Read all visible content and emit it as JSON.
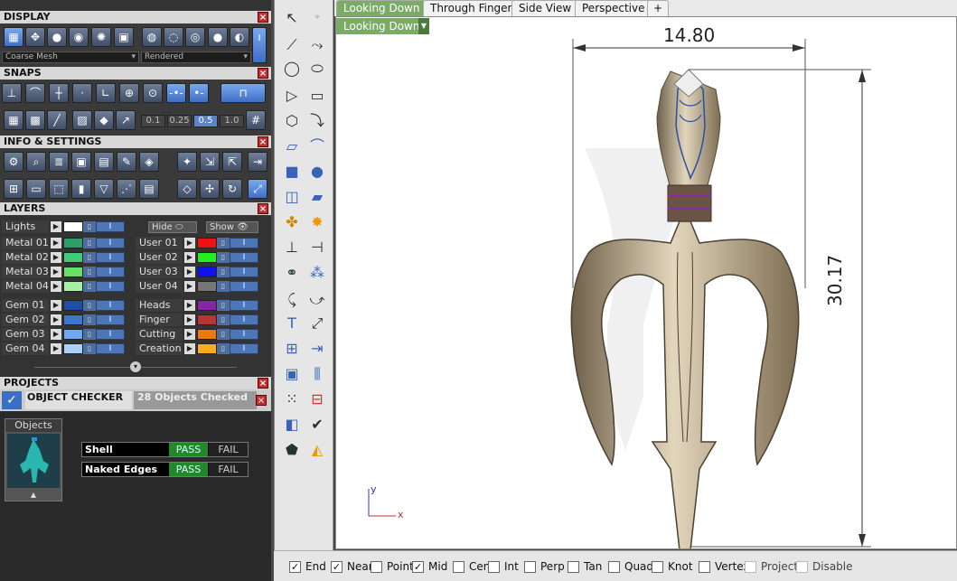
{
  "display": {
    "title": "DISPLAY",
    "mesh_select": "Coarse Mesh",
    "render_select": "Rendered"
  },
  "snaps": {
    "title": "SNAPS",
    "steps": [
      "0.1",
      "0.25",
      "0.5",
      "1.0"
    ],
    "active_step": "0.5"
  },
  "info": {
    "title": "INFO & SETTINGS"
  },
  "layers": {
    "title": "LAYERS",
    "lights_label": "Lights",
    "hide_label": "Hide",
    "show_label": "Show",
    "left": [
      {
        "name": "Metal 01",
        "color": "#2e9e6a"
      },
      {
        "name": "Metal 02",
        "color": "#3fcc7a"
      },
      {
        "name": "Metal 03",
        "color": "#66e066"
      },
      {
        "name": "Metal 04",
        "color": "#a8f0a8"
      },
      {
        "name": "Gem 01",
        "color": "#1f4da8"
      },
      {
        "name": "Gem 02",
        "color": "#3d78cc"
      },
      {
        "name": "Gem 03",
        "color": "#6fa8ee"
      },
      {
        "name": "Gem 04",
        "color": "#a8d0f8"
      }
    ],
    "right": [
      {
        "name": "User 01",
        "color": "#ee1111"
      },
      {
        "name": "User 02",
        "color": "#22ee22"
      },
      {
        "name": "User 03",
        "color": "#1111ee"
      },
      {
        "name": "User 04",
        "color": "#777777"
      },
      {
        "name": "Heads",
        "color": "#8a22aa"
      },
      {
        "name": "Finger",
        "color": "#bb3333"
      },
      {
        "name": "Cutting",
        "color": "#ee7711"
      },
      {
        "name": "Creation",
        "color": "#ffaa22"
      }
    ]
  },
  "projects": {
    "title": "PROJECTS"
  },
  "checker": {
    "title": "OBJECT CHECKER",
    "status": "28  Objects Checked",
    "objects_label": "Objects",
    "rows": [
      {
        "label": "Shell",
        "pass": "PASS",
        "fail": "FAIL"
      },
      {
        "label": "Naked Edges",
        "pass": "PASS",
        "fail": "FAIL"
      }
    ]
  },
  "tabs": [
    "Looking Down",
    "Through Finger",
    "Side View",
    "Perspective"
  ],
  "add_tab": "+",
  "viewport": {
    "title": "Looking Down",
    "dim_width": "14.80",
    "dim_height": "30.17",
    "axis_x": "x",
    "axis_y": "y"
  },
  "status_snaps": [
    {
      "label": "End",
      "checked": true
    },
    {
      "label": "Near",
      "checked": true
    },
    {
      "label": "Point",
      "checked": false
    },
    {
      "label": "Mid",
      "checked": true
    },
    {
      "label": "Cen",
      "checked": false
    },
    {
      "label": "Int",
      "checked": false
    },
    {
      "label": "Perp",
      "checked": false
    },
    {
      "label": "Tan",
      "checked": false
    },
    {
      "label": "Quad",
      "checked": false
    },
    {
      "label": "Knot",
      "checked": false
    },
    {
      "label": "Vertex",
      "checked": false
    },
    {
      "label": "Project",
      "checked": false,
      "dim": true
    },
    {
      "label": "Disable",
      "checked": false,
      "dim": true
    }
  ],
  "colors": {
    "accent": "#7aac66",
    "pass": "#208a2a",
    "close": "#c03030"
  }
}
